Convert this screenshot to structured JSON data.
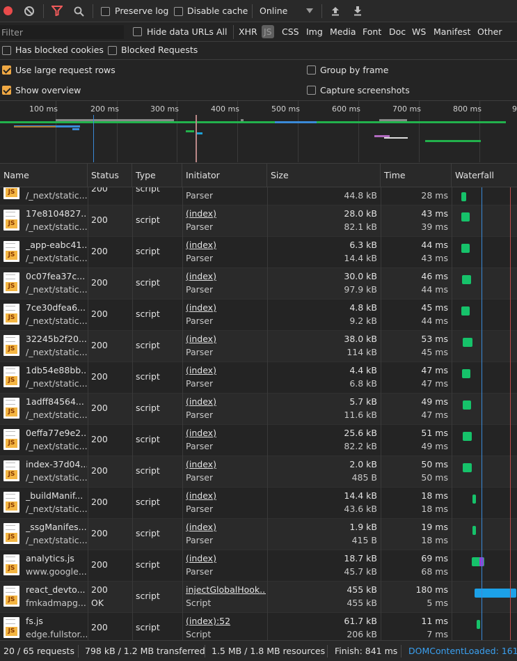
{
  "toolbar": {
    "preserve_log": "Preserve log",
    "disable_cache": "Disable cache",
    "throttle": "Online"
  },
  "filterbar": {
    "filter_placeholder": "Filter",
    "hide_data_urls": "Hide data URLs",
    "types": [
      "All",
      "XHR",
      "JS",
      "CSS",
      "Img",
      "Media",
      "Font",
      "Doc",
      "WS",
      "Manifest",
      "Other"
    ],
    "selected": "JS"
  },
  "options": {
    "has_blocked_cookies": "Has blocked cookies",
    "blocked_requests": "Blocked Requests",
    "large_rows": "Use large request rows",
    "group_by_frame": "Group by frame",
    "show_overview": "Show overview",
    "capture_screenshots": "Capture screenshots"
  },
  "overview": {
    "ticks": [
      "100 ms",
      "200 ms",
      "300 ms",
      "400 ms",
      "500 ms",
      "600 ms",
      "700 ms",
      "800 ms",
      "9"
    ]
  },
  "columns": {
    "name": "Name",
    "status": "Status",
    "type": "Type",
    "initiator": "Initiator",
    "size": "Size",
    "time": "Time",
    "waterfall": "Waterfall"
  },
  "rows": [
    {
      "name": "",
      "path": "/_next/static...",
      "status": "200",
      "status2": "",
      "type": "script",
      "init": "",
      "init2": "Parser",
      "size": "",
      "size2": "44.8 kB",
      "time": "",
      "time2": "28 ms"
    },
    {
      "name": "17e8104827...",
      "path": "/_next/static...",
      "status": "200",
      "status2": "",
      "type": "script",
      "init": "(index)",
      "init2": "Parser",
      "size": "28.0 kB",
      "size2": "82.1 kB",
      "time": "43 ms",
      "time2": "39 ms"
    },
    {
      "name": "_app-eabc41...",
      "path": "/_next/static...",
      "status": "200",
      "status2": "",
      "type": "script",
      "init": "(index)",
      "init2": "Parser",
      "size": "6.3 kB",
      "size2": "14.4 kB",
      "time": "44 ms",
      "time2": "43 ms"
    },
    {
      "name": "0c07fea37c...",
      "path": "/_next/static...",
      "status": "200",
      "status2": "",
      "type": "script",
      "init": "(index)",
      "init2": "Parser",
      "size": "30.0 kB",
      "size2": "97.9 kB",
      "time": "46 ms",
      "time2": "44 ms"
    },
    {
      "name": "7ce30dfea6...",
      "path": "/_next/static...",
      "status": "200",
      "status2": "",
      "type": "script",
      "init": "(index)",
      "init2": "Parser",
      "size": "4.8 kB",
      "size2": "9.2 kB",
      "time": "45 ms",
      "time2": "44 ms"
    },
    {
      "name": "32245b2f20...",
      "path": "/_next/static...",
      "status": "200",
      "status2": "",
      "type": "script",
      "init": "(index)",
      "init2": "Parser",
      "size": "38.0 kB",
      "size2": "114 kB",
      "time": "53 ms",
      "time2": "45 ms"
    },
    {
      "name": "1db54e88bb...",
      "path": "/_next/static...",
      "status": "200",
      "status2": "",
      "type": "script",
      "init": "(index)",
      "init2": "Parser",
      "size": "4.4 kB",
      "size2": "6.8 kB",
      "time": "47 ms",
      "time2": "47 ms"
    },
    {
      "name": "1adff84564...",
      "path": "/_next/static...",
      "status": "200",
      "status2": "",
      "type": "script",
      "init": "(index)",
      "init2": "Parser",
      "size": "5.7 kB",
      "size2": "11.6 kB",
      "time": "49 ms",
      "time2": "47 ms"
    },
    {
      "name": "0effa77e9e2...",
      "path": "/_next/static...",
      "status": "200",
      "status2": "",
      "type": "script",
      "init": "(index)",
      "init2": "Parser",
      "size": "25.6 kB",
      "size2": "82.2 kB",
      "time": "51 ms",
      "time2": "49 ms"
    },
    {
      "name": "index-37d04...",
      "path": "/_next/static...",
      "status": "200",
      "status2": "",
      "type": "script",
      "init": "(index)",
      "init2": "Parser",
      "size": "2.0 kB",
      "size2": "485 B",
      "time": "50 ms",
      "time2": "50 ms"
    },
    {
      "name": "_buildManif...",
      "path": "/_next/static...",
      "status": "200",
      "status2": "",
      "type": "script",
      "init": "(index)",
      "init2": "Parser",
      "size": "14.4 kB",
      "size2": "43.6 kB",
      "time": "18 ms",
      "time2": "18 ms"
    },
    {
      "name": "_ssgManifes...",
      "path": "/_next/static...",
      "status": "200",
      "status2": "",
      "type": "script",
      "init": "(index)",
      "init2": "Parser",
      "size": "1.9 kB",
      "size2": "415 B",
      "time": "19 ms",
      "time2": "18 ms"
    },
    {
      "name": "analytics.js",
      "path": "www.google...",
      "status": "200",
      "status2": "",
      "type": "script",
      "init": "(index)",
      "init2": "Parser",
      "size": "18.7 kB",
      "size2": "45.7 kB",
      "time": "69 ms",
      "time2": "68 ms"
    },
    {
      "name": "react_devto...",
      "path": "fmkadmapg...",
      "status": "200",
      "status2": "OK",
      "type": "script",
      "init": "injectGlobalHook...",
      "init2": "Script",
      "size": "455 kB",
      "size2": "455 kB",
      "time": "180 ms",
      "time2": "5 ms"
    },
    {
      "name": "fs.js",
      "path": "edge.fullstor...",
      "status": "200",
      "status2": "",
      "type": "script",
      "init": "(index):52",
      "init2": "Script",
      "size": "61.7 kB",
      "size2": "206 kB",
      "time": "11 ms",
      "time2": "7 ms"
    }
  ],
  "footer": {
    "requests": "20 / 65 requests",
    "transferred": "798 kB / 1.2 MB transferred",
    "resources": "1.5 MB / 1.8 MB resources",
    "finish": "Finish: 841 ms",
    "dcl": "DOMContentLoaded: 161 r"
  }
}
